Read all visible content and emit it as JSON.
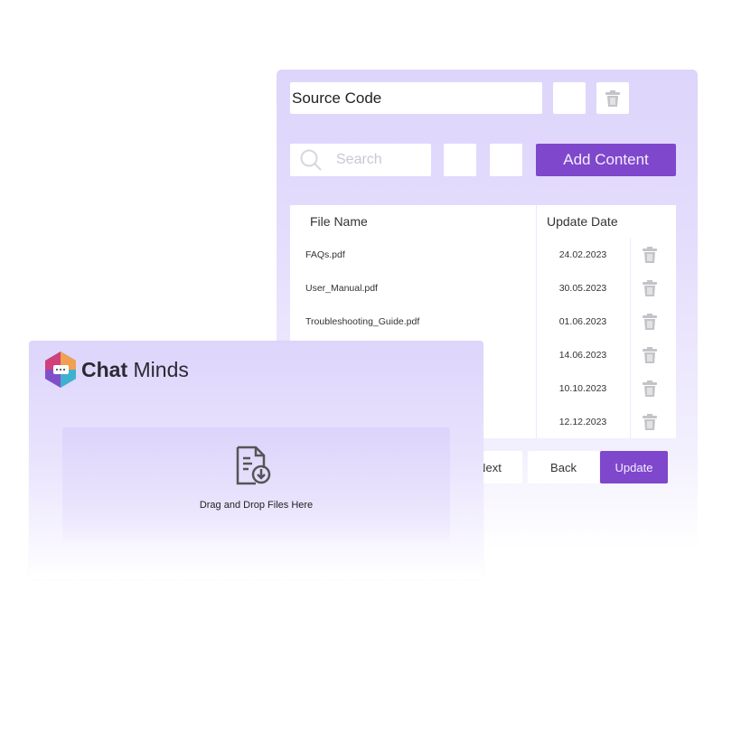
{
  "source_panel": {
    "title_value": "Source Code",
    "search_placeholder": "Search",
    "add_content_label": "Add Content",
    "table": {
      "headers": [
        "File Name",
        "Update Date"
      ],
      "rows": [
        {
          "name": "FAQs.pdf",
          "date": "24.02.2023"
        },
        {
          "name": "User_Manual.pdf",
          "date": "30.05.2023"
        },
        {
          "name": "Troubleshooting_Guide.pdf",
          "date": "01.06.2023"
        },
        {
          "name": "",
          "date": "14.06.2023"
        },
        {
          "name": "",
          "date": "10.10.2023"
        },
        {
          "name": "",
          "date": "12.12.2023"
        }
      ]
    },
    "next_label": "Next",
    "back_label": "Back",
    "update_label": "Update"
  },
  "upload_card": {
    "brand_bold": "Chat",
    "brand_light": " Minds",
    "drop_text": "Drag and Drop Files Here"
  },
  "colors": {
    "accent": "#7f47cc",
    "panel": "#ddd5fb",
    "trash": "#c4c4c8"
  }
}
